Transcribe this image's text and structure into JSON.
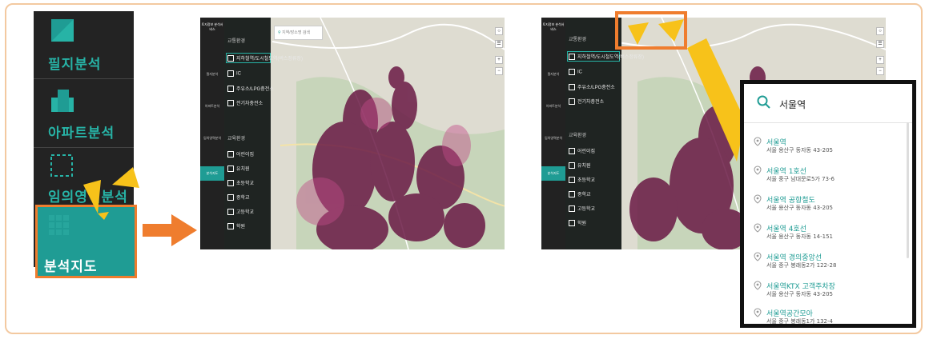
{
  "sidebar": {
    "items": [
      {
        "label": "필지분석"
      },
      {
        "label": "아파트분석"
      },
      {
        "label": "임의영역분석"
      },
      {
        "label": "분석지도"
      }
    ]
  },
  "map_panel_1": {
    "brand": "토지정보 분석서비스",
    "nav": [
      "필지분석",
      "아파트분석",
      "임의영역분석",
      "분석지도"
    ],
    "group1_title": "교통환경",
    "group1": [
      "지하철역/도시철도역(버스정류장)",
      "IC",
      "주유소/LPG충전소",
      "전기차충전소"
    ],
    "group2_title": "교육환경",
    "group2": [
      "어린이집",
      "유치원",
      "초등학교",
      "중학교",
      "고등학교",
      "학원"
    ],
    "search_placeholder": "지역/장소명 검색"
  },
  "map_panel_2": {
    "brand": "토지정보 분석서비스",
    "nav": [
      "필지분석",
      "아파트분석",
      "임의영역분석",
      "분석지도"
    ],
    "group1_title": "교통환경",
    "group1": [
      "지하철역/도시철도역(버스정류장)",
      "IC",
      "주유소/LPG충전소",
      "전기차충전소"
    ],
    "group2_title": "교육환경",
    "group2": [
      "어린이집",
      "유치원",
      "초등학교",
      "중학교",
      "고등학교",
      "학원"
    ]
  },
  "search_popup": {
    "query": "서울역",
    "results": [
      {
        "title": "서울역",
        "address": "서울 용산구 동자동 43-205"
      },
      {
        "title": "서울역 1호선",
        "address": "서울 중구 남대문로5가 73-6"
      },
      {
        "title": "서울역 공항철도",
        "address": "서울 용산구 동자동 43-205"
      },
      {
        "title": "서울역 4호선",
        "address": "서울 용산구 동자동 14-151"
      },
      {
        "title": "서울역 경의중앙선",
        "address": "서울 중구 봉래동2가 122-28"
      },
      {
        "title": "서울역KTX 고객주차장",
        "address": "서울 용산구 동자동 43-205"
      },
      {
        "title": "서울역공간모아",
        "address": "서울 중구 봉래동1가 132-4"
      }
    ]
  },
  "colors": {
    "accent": "#1f9c94",
    "highlight": "#ef7d2e",
    "callout": "#f7c21a",
    "heat": "#6a1a45"
  }
}
